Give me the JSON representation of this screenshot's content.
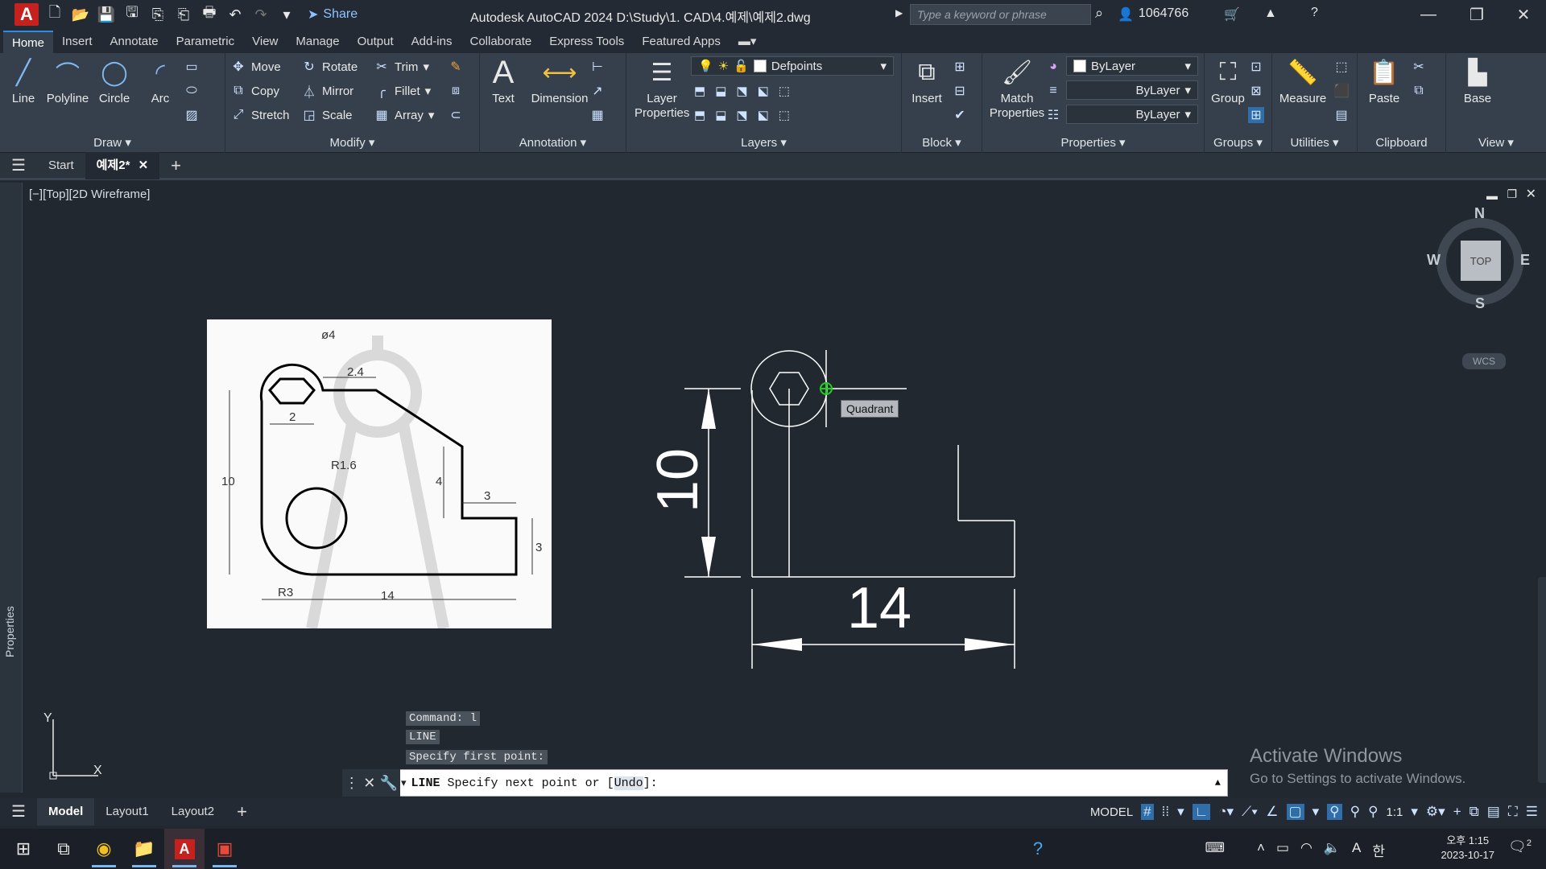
{
  "title_bar": {
    "app_letter": "A",
    "share_label": "Share",
    "window_title": "Autodesk AutoCAD 2024    D:\\Study\\1. CAD\\4.예제\\예제2.dwg",
    "search_placeholder": "Type a keyword or phrase",
    "user_name": "1064766"
  },
  "ribbon_tabs": [
    "Home",
    "Insert",
    "Annotate",
    "Parametric",
    "View",
    "Manage",
    "Output",
    "Add-ins",
    "Collaborate",
    "Express Tools",
    "Featured Apps"
  ],
  "ribbon": {
    "draw": {
      "title": "Draw",
      "line": "Line",
      "polyline": "Polyline",
      "circle": "Circle",
      "arc": "Arc"
    },
    "modify": {
      "title": "Modify",
      "move": "Move",
      "rotate": "Rotate",
      "trim": "Trim",
      "copy": "Copy",
      "mirror": "Mirror",
      "fillet": "Fillet",
      "stretch": "Stretch",
      "scale": "Scale",
      "array": "Array"
    },
    "annotation": {
      "title": "Annotation",
      "text": "Text",
      "dimension": "Dimension"
    },
    "layers": {
      "title": "Layers",
      "layer_properties": "Layer Properties",
      "current_layer": "Defpoints"
    },
    "block": {
      "title": "Block",
      "insert": "Insert"
    },
    "properties": {
      "title": "Properties",
      "match": "Match Properties",
      "color": "ByLayer",
      "linetype": "ByLayer",
      "lineweight": "ByLayer"
    },
    "groups": {
      "title": "Groups",
      "group": "Group"
    },
    "utilities": {
      "title": "Utilities",
      "measure": "Measure"
    },
    "clipboard": {
      "title": "Clipboard",
      "paste": "Paste"
    },
    "view": {
      "title": "View",
      "base": "Base"
    }
  },
  "doc_tabs": {
    "start": "Start",
    "current": "예제2*"
  },
  "viewport": {
    "label": "[−][Top][2D Wireframe]",
    "properties_palette": "Properties",
    "viewcube": {
      "n": "N",
      "s": "S",
      "e": "E",
      "w": "W",
      "face": "TOP",
      "wcs": "WCS"
    },
    "snap_tooltip": "Quadrant",
    "dim_vertical": "10",
    "dim_horizontal": "14",
    "ucs_y": "Y",
    "ucs_x": "X"
  },
  "reference": {
    "d_phi4": "ø4",
    "d_24": "2.4",
    "d_2": "2",
    "d_10": "10",
    "d_r16": "R1.6",
    "d_4": "4",
    "d_3a": "3",
    "d_3b": "3",
    "d_r3": "R3",
    "d_14": "14"
  },
  "command": {
    "history": [
      "Command: l",
      "LINE",
      "Specify first point:"
    ],
    "prompt_cmd": "LINE",
    "prompt_text": " Specify next point or [",
    "prompt_option": "Undo",
    "prompt_end": "]:"
  },
  "watermark": {
    "line1": "Activate Windows",
    "line2": "Go to Settings to activate Windows."
  },
  "layout_tabs": [
    "Model",
    "Layout1",
    "Layout2"
  ],
  "status": {
    "model": "MODEL",
    "scale": "1:1"
  },
  "clock": {
    "time": "오후 1:15",
    "date": "2023-10-17"
  },
  "tray": {
    "ime": "A",
    "lang": "한",
    "notif_count": "2"
  }
}
